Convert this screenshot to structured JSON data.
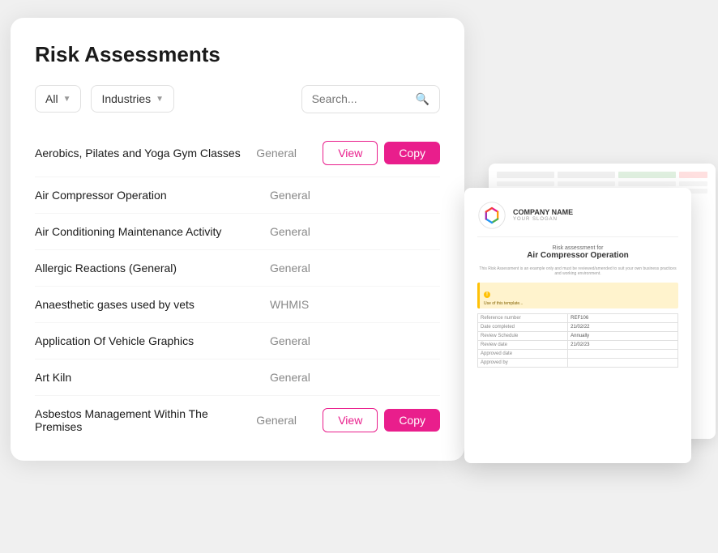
{
  "page": {
    "title": "Risk Assessments"
  },
  "filters": {
    "all_label": "All",
    "industries_label": "Industries",
    "search_placeholder": "Search..."
  },
  "assessments": [
    {
      "id": 1,
      "name": "Aerobics, Pilates and Yoga Gym Classes",
      "category": "General",
      "has_view": true,
      "has_copy": true
    },
    {
      "id": 2,
      "name": "Air Compressor Operation",
      "category": "General",
      "has_view": false,
      "has_copy": false
    },
    {
      "id": 3,
      "name": "Air Conditioning Maintenance Activity",
      "category": "General",
      "has_view": false,
      "has_copy": false
    },
    {
      "id": 4,
      "name": "Allergic Reactions (General)",
      "category": "General",
      "has_view": false,
      "has_copy": false
    },
    {
      "id": 5,
      "name": "Anaesthetic gases used by vets",
      "category": "WHMIS",
      "has_view": false,
      "has_copy": false
    },
    {
      "id": 6,
      "name": "Application Of Vehicle Graphics",
      "category": "General",
      "has_view": false,
      "has_copy": false
    },
    {
      "id": 7,
      "name": "Art Kiln",
      "category": "General",
      "has_view": false,
      "has_copy": false
    },
    {
      "id": 8,
      "name": "Asbestos Management Within The Premises",
      "category": "General",
      "has_view": true,
      "has_copy": true
    }
  ],
  "preview_card": {
    "company_name": "COMPANY NAME",
    "company_slogan": "YOUR SLOGAN",
    "risk_for_label": "Risk assessment for",
    "doc_title": "Air Compressor Operation",
    "disclaimer": "This Risk Assessment is an example only and must be reviewed/amended to suit your own business practices and working environment.",
    "reference_label": "Reference number",
    "reference_value": "REF106",
    "date_label": "Date completed",
    "date_value": "21/02/22",
    "review_schedule_label": "Review Schedule",
    "review_schedule_value": "Annually",
    "review_date_label": "Review date",
    "review_date_value": "21/02/23",
    "approved_date_label": "Approved date",
    "approved_by_label": "Approved by"
  },
  "buttons": {
    "view_label": "View",
    "copy_label": "Copy"
  }
}
